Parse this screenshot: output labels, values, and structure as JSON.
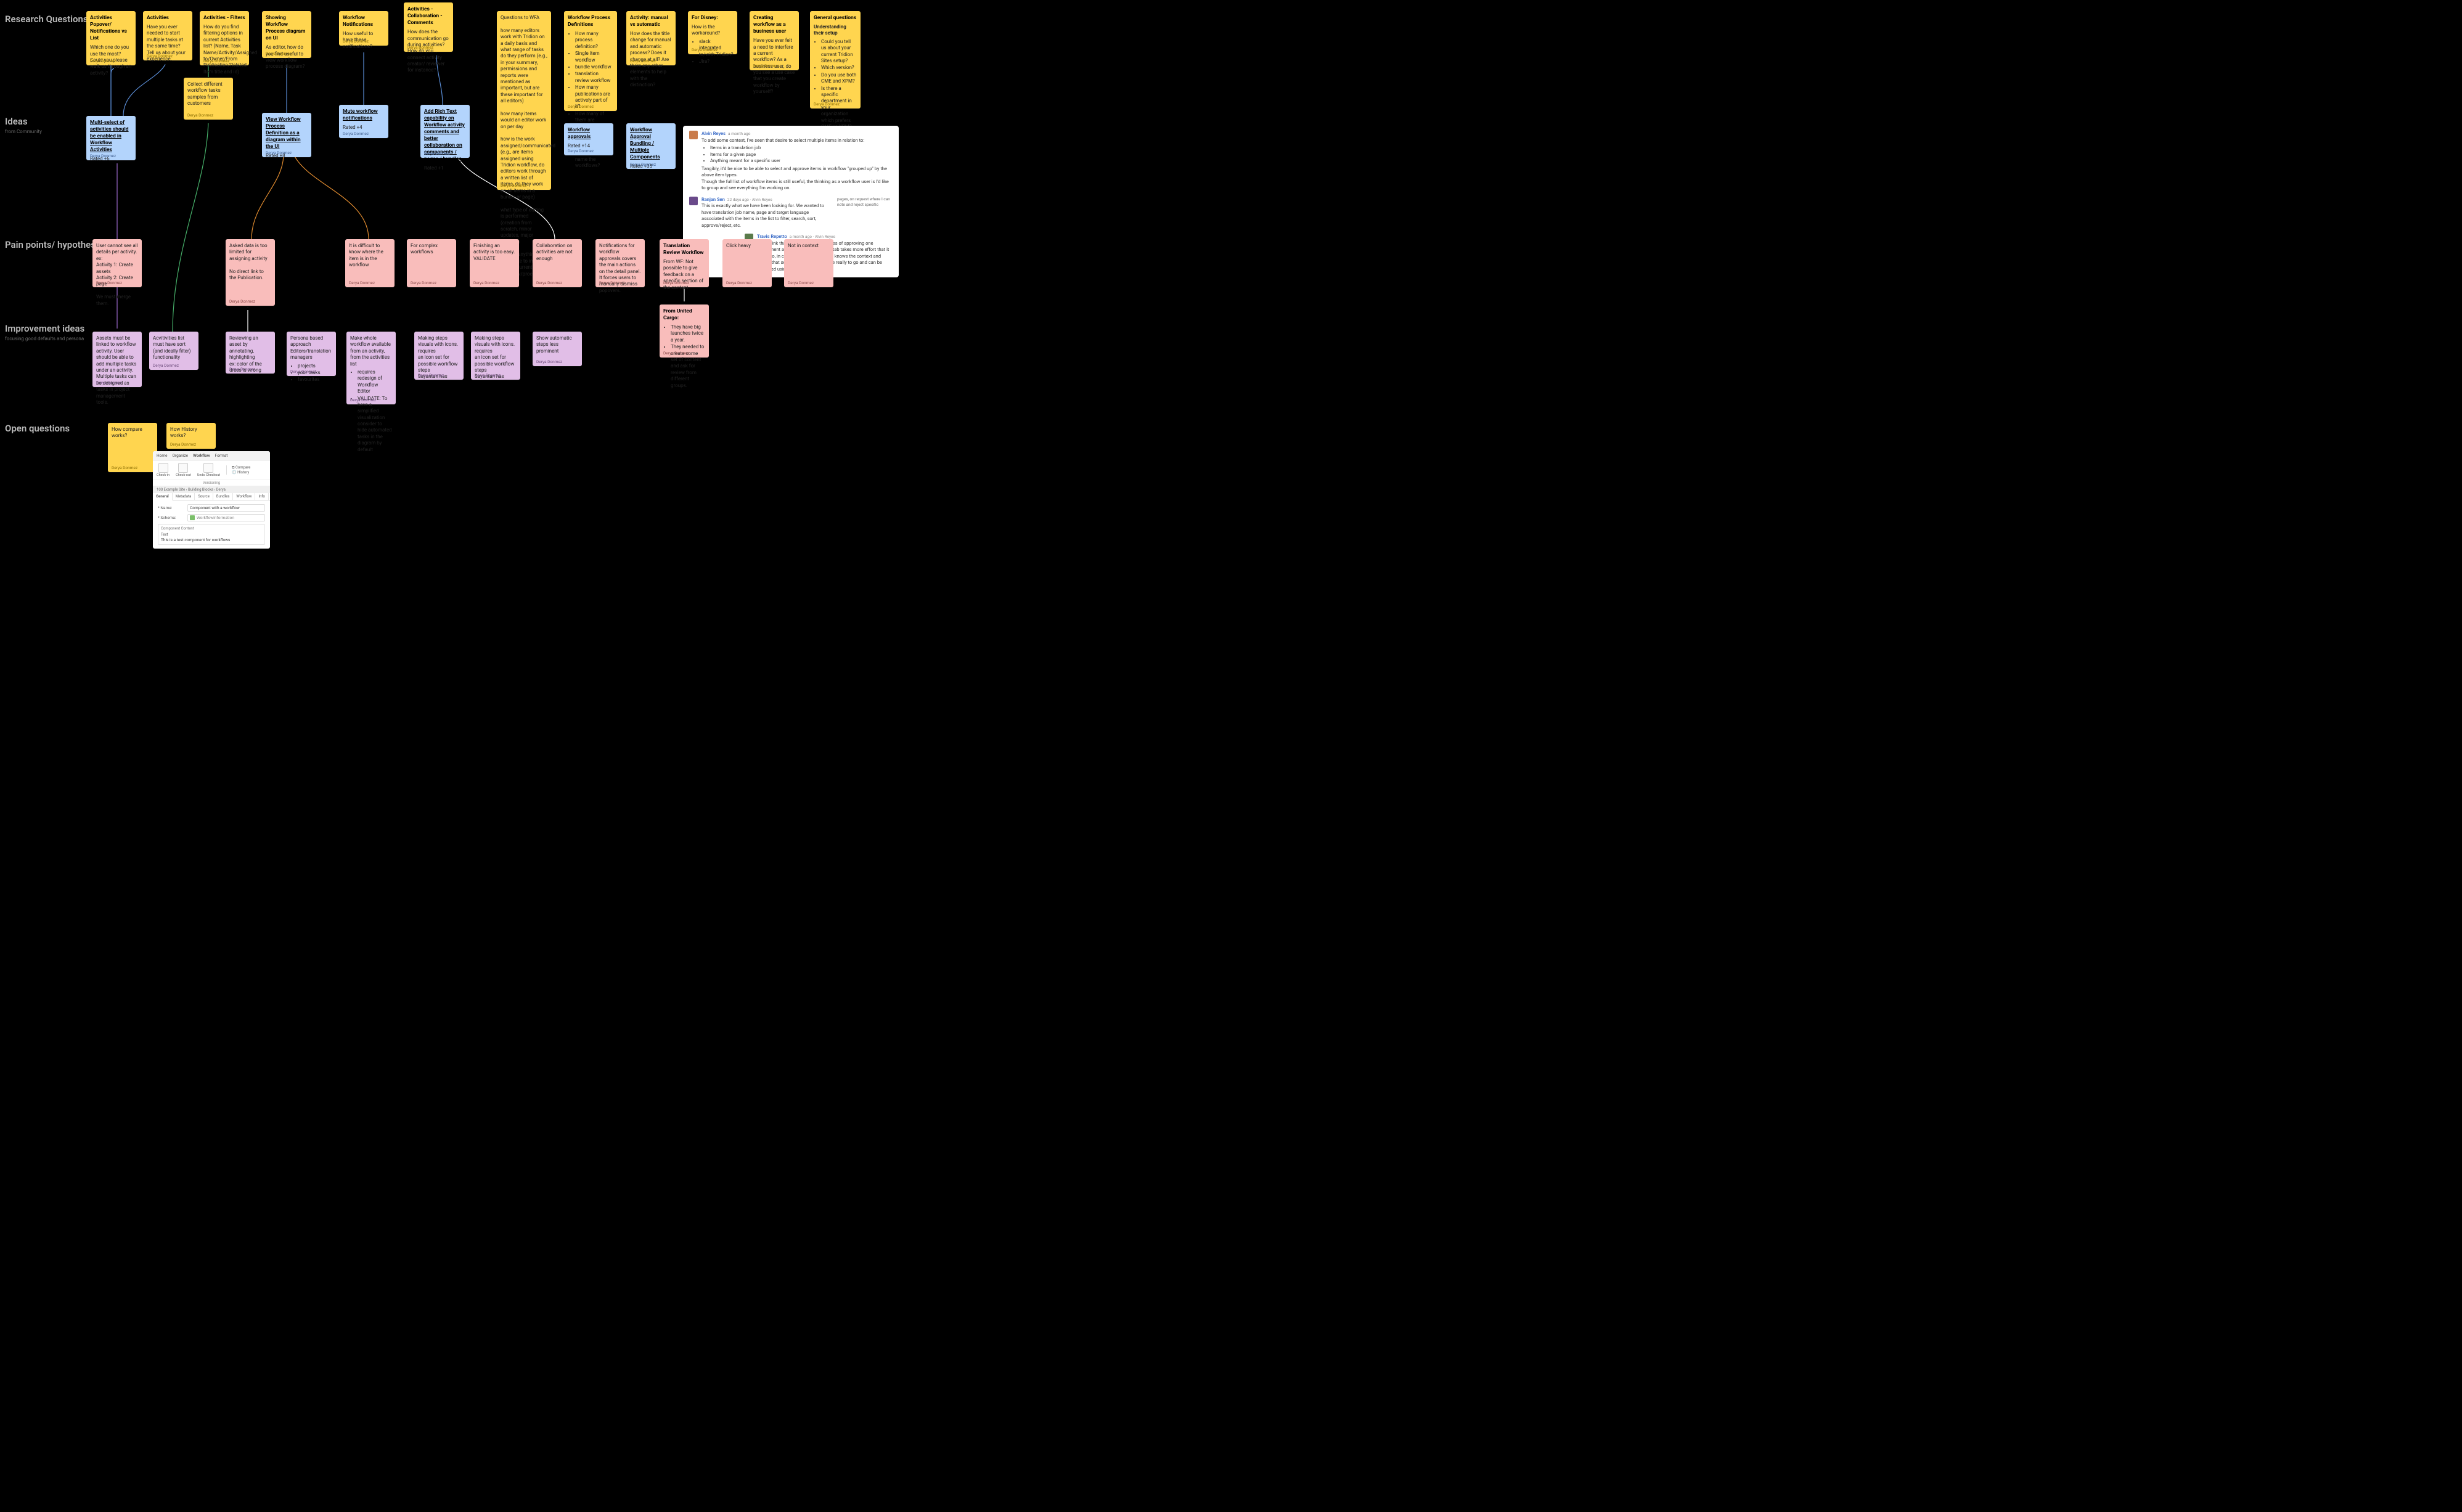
{
  "labels": {
    "research": {
      "title": "Research Questions"
    },
    "ideas": {
      "title": "Ideas",
      "sub": "from Community"
    },
    "pain": {
      "title": "Pain points/ hypothesis"
    },
    "improve": {
      "title": "Improvement ideas",
      "sub": "focusing good defaults and persona"
    },
    "open": {
      "title": "Open questions"
    }
  },
  "sig": "Derya Donmez",
  "rq": {
    "n1": {
      "t": "Activities Popover/ Notifications vs List",
      "b": "Which one do you use the most?\n\nCould you please walk us through an activity?"
    },
    "n2": {
      "t": "Activities",
      "b": "Have you ever needed to start multiple tasks at the same time?\nTell us about your experience."
    },
    "n3": {
      "t": "Activities - Filters",
      "b": "How do you find filtering options in current Activities list?\n(Name, Task Name/Activity/Assigned to/Owner/From Publication/Related Item title and id)"
    },
    "n4": {
      "t": "Showing Workflow Process diagram on UI",
      "b": "As editor, how do you find useful to view workflow process diagram?"
    },
    "n5": {
      "t": "Workflow Notifications",
      "b": "How useful to have these notifications?"
    },
    "n6": {
      "t": "Activities - Collaboration - Comments",
      "b": "How does the communication go during activities? How do you connect activity creator/ reviewer for instance?"
    },
    "n7": {
      "t": "",
      "b": "Questions to WFA\n\nhow many editors work with Tridion on a daily basis and what range of tasks do they perform (e.g., in your summary, permissions and reports were mentioned as important, but are these important for all editors)\n\nhow many items would an editor work on per day\n\nhow is the work assigned/communicated (e.g., are items assigned using Tridion workflow, do editors work through a written list of items, do they work on all items in a bundle or page)\n\nwhat type of editing is performed (creation from scratch, minor updates, major rewrites)\n\nis there anything they'd like to improve in their current workflow/process"
    },
    "n8": {
      "t": "Workflow Process Definitions",
      "list": [
        "How many process definition?",
        "Single item workflow",
        "bundle workflow",
        "translation review workflow",
        "How many publications are actively part of it?",
        "How many of them are generally assigned to you?",
        "Naming Conventions? How do you name the workflows?"
      ]
    },
    "n9": {
      "t": "Activity: manual vs automatic",
      "b": "How does the title change for manual and automatic process? Does it change at all? Are there any other elements to help with the distinction?"
    },
    "n10": {
      "t": "For Disney:",
      "b": "How is the workaround?",
      "list": [
        "slack integrated to/with Tridion?",
        "Jira?"
      ]
    },
    "n11": {
      "t": "Creating workflow as a business user",
      "b": "Have you ever felt a need to interfere a current workflow?\nAs a business user, do you see a use case that you create workflow by yourself?"
    },
    "n12": {
      "t": "General questions",
      "b": "Understanding their setup",
      "list": [
        "Could you tell us about your current Tridion Sites setup?",
        "Which version?",
        "Do you use both CME and XPM?",
        "Is there a specific department in your organization which prefers CME vs XPM?"
      ]
    },
    "collect": {
      "b": "Collect different workflow tasks samples from customers"
    }
  },
  "ideas": {
    "i1": {
      "t": "Multi-select of activities should be enabled in Workflow Activities",
      "r": "Rated +6"
    },
    "i2": {
      "t": "View Workflow Process Definition as a diagram within the UI",
      "r": "Rated +8"
    },
    "i3": {
      "t": "Mute workflow notifications",
      "r": "Rated +4"
    },
    "i4": {
      "t": "Add Rich Text capability on Workflow activity comments and better collaboration on components / pages / bundles",
      "r": "Rated +1"
    },
    "i5": {
      "t": "Workflow approvals",
      "r": "Rated +14"
    },
    "i6": {
      "t": "Workflow Approval Bundling / Multiple Components",
      "r": "Rated +35"
    }
  },
  "pain": {
    "p1": {
      "b": "User cannot see all details per activity.\nex:\nActivity 1: Create assets\nActivity 2: Create page\n\nWe must merge them."
    },
    "p2": {
      "b": "Asked data is too limited for assigning activity\n\nNo direct link to the Publication."
    },
    "p3": {
      "b": "It is difficult to know where the item is in the workflow"
    },
    "p4": {
      "b": "For complex workflows"
    },
    "p5": {
      "b": "Finishing an activity is too easy.\nVALIDATE"
    },
    "p6": {
      "b": "Collaboration on activities are not enough"
    },
    "p7": {
      "b": "Notifications for workflow approvals covers the main actions on the detail panel. It forces users to manually dismiss popovers."
    },
    "p8": {
      "t": "Translation Review Workflow",
      "b": "From WF: Not possible to give feedback on a specific section of the content"
    },
    "p9": {
      "b": "Click heavy"
    },
    "p10": {
      "b": "Not in context"
    },
    "p11": {
      "t": "From United Cargo:",
      "list": [
        "They have big launches twice a year.",
        "They needed to create some set of content and ask for review from different groups."
      ]
    }
  },
  "imp": {
    "m1": {
      "b": "Assets must be linked to workflow activity. User should be able to add multiple tasks under an activity. Multiple tasks can be designed as tasks in project management tools."
    },
    "m2": {
      "b": "Acvitivities list must have sort (and ideally filter) functionality"
    },
    "m3": {
      "b": "Reviewing an asset by annotating, highlighting\nex: color of the dress is wrong"
    },
    "m4": {
      "b": "Persona based approach Editors/translation managers",
      "list": [
        "projects",
        "your tasks",
        "favourites"
      ]
    },
    "m5": {
      "b": "Make whole workflow available from an activity, from the activities list",
      "list": [
        "requires redesign of Workflow Editor",
        "VALIDATE: To have a simplified visualization consider to hide automated tasks in the diagram by default"
      ]
    },
    "m6": {
      "b": "Making steps visuals with icons.\nrequires\nan icon set for possible workflow steps\nSayantan has"
    },
    "m7": {
      "b": "Making steps visuals with icons.\nrequires\nan icon set for possible workflow steps\nSayantan has"
    },
    "m8": {
      "b": "Show automatic steps less prominent"
    }
  },
  "open": {
    "o1": {
      "b": "How compare works?"
    },
    "o2": {
      "b": "How History works?"
    }
  },
  "comments": {
    "c1": {
      "name": "Alvin Reyes",
      "meta": "a month ago",
      "body": "To add some context, I've seen that desire to select multiple items in relation to:",
      "list": [
        "Items in a translation job",
        "Items for a given page",
        "Anything meant for a specific user"
      ],
      "tail": "Tangibly, it'd be nice to be able to select and approve items in workflow \"grouped up\" by the above item types.\nThough the full list of workflow items is still useful, the thinking as a workflow user is I'd like to group and see everything I'm working on."
    },
    "c2": {
      "name": "Ranjan Sen",
      "meta": "22 days ago · Alvin Reyes",
      "body": "This is exactly what we have been looking for. We wanted to have translation job name, page and target language associated with the items in the list to filter, search, sort, approve/reject, etc.",
      "side": "pages, on request where I can note and reject specific"
    },
    "c3": {
      "name": "Travis Repetto",
      "meta": "a month ago · Alvin Reyes",
      "body": "Yes I think that sums it up. The process of approving one component at a time in the activities tab takes more effort that it needs to, in cases where the reviewer knows the context and knows that several separate items are really to go and can be approved using a single action."
    }
  },
  "mini": {
    "ribbon": [
      "Home",
      "Organize",
      "Workflow",
      "Format"
    ],
    "tools": {
      "checkin": "Check-in",
      "checkout": "Check-out",
      "undo": "Undo Checkout",
      "compare": "Compare",
      "history": "History"
    },
    "crumbs": "100 Example Site › Building Blocks › Derya",
    "tabs": [
      "General",
      "Metadata",
      "Source",
      "Bundles",
      "Workflow",
      "Info"
    ],
    "group": "Versioning",
    "fields": {
      "name_label": "* Name:",
      "name_value": "Component with a workflow",
      "schema_label": "* Schema:",
      "schema_value": "WorkflowInformation",
      "section": "Component Content",
      "text_label": "Text",
      "text_value": "This is a test component for workflows"
    }
  }
}
